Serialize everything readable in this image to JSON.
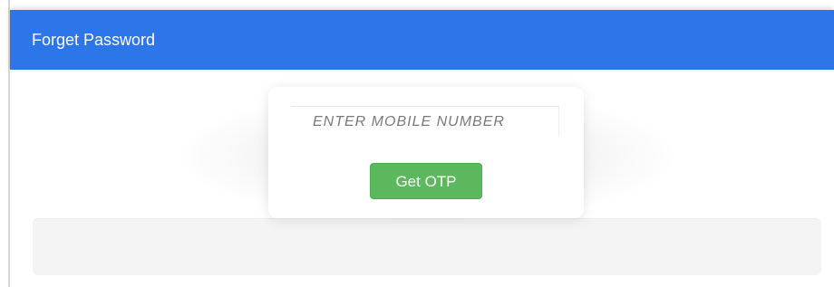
{
  "header": {
    "title": "Forget Password",
    "background_color": "#2d76ea"
  },
  "form": {
    "mobile_input": {
      "placeholder": "ENTER MOBILE NUMBER",
      "value": ""
    },
    "submit_button": {
      "label": "Get OTP",
      "color": "#5cb85c"
    }
  }
}
